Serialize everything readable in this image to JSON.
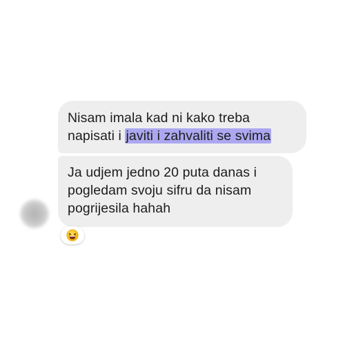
{
  "conversation": {
    "messages": [
      {
        "lines": [
          {
            "text": "Nisam imala kad ni kako treba"
          },
          {
            "prefix": "napisati i ",
            "highlighted": "javiti i zahvaliti se svima"
          }
        ]
      },
      {
        "lines": [
          {
            "text": "Ja udjem jedno 20 puta danas i"
          },
          {
            "text": "pogledam svoju sifru da nisam"
          },
          {
            "text": "pogrijesila hahah"
          }
        ],
        "reaction": {
          "icon": "laughing-face-emoji-icon",
          "emoji": "😆"
        }
      }
    ],
    "avatar": {
      "icon": "blurred-avatar"
    }
  },
  "colors": {
    "bubble_background": "#eeeeee",
    "text": "#1c1c1c",
    "highlight": "#aba8f0",
    "page_background": "#ffffff"
  }
}
